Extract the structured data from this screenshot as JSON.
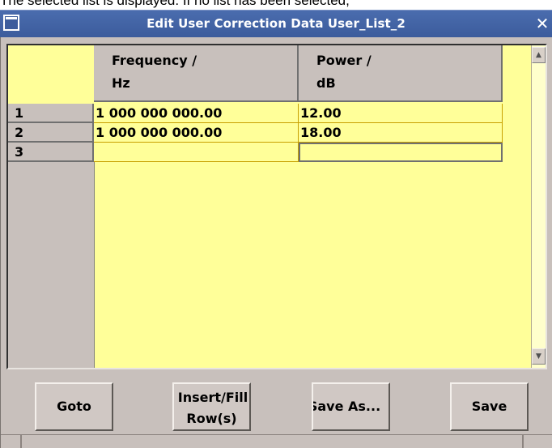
{
  "document": {
    "clipped_text": "The selected list is displayed. If no list has been selected,"
  },
  "window": {
    "title": "Edit User Correction Data  User_List_2",
    "close_glyph": "✕"
  },
  "table": {
    "columns": [
      {
        "line1": "Frequency /",
        "line2": "Hz"
      },
      {
        "line1": "Power /",
        "line2": "dB"
      }
    ],
    "rows": [
      {
        "index": "1",
        "frequency": "1 000 000 000.00",
        "power": "12.00"
      },
      {
        "index": "2",
        "frequency": "1 000 000 000.00",
        "power": "18.00"
      },
      {
        "index": "3",
        "frequency": "",
        "power": ""
      }
    ],
    "selected_cell": {
      "row": 3,
      "column": "power"
    }
  },
  "scrollbar": {
    "up_glyph": "▲",
    "down_glyph": "▼"
  },
  "buttons": {
    "goto": "Goto",
    "insert_line1": "Insert/Fill",
    "insert_line2": "Row(s)",
    "save_as": "Save As...",
    "save": "Save"
  },
  "colors": {
    "title_bar": "#3c5c9c",
    "table_bg": "#ffff99",
    "frame": "#c8c0bc"
  }
}
